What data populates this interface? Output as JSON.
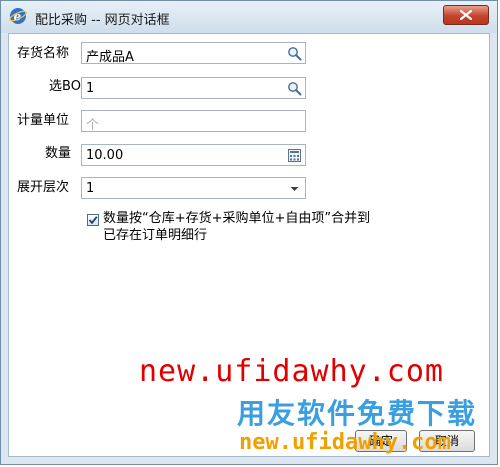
{
  "window": {
    "title": "配比采购 -- 网页对话框"
  },
  "form": {
    "inventory_name": {
      "label": "存货名称",
      "value": "产成品A"
    },
    "bom": {
      "label": "选BOM",
      "value": "1"
    },
    "unit": {
      "label": "计量单位",
      "placeholder": "个"
    },
    "quantity": {
      "label": "数量",
      "value": "10.00"
    },
    "level": {
      "label": "展开层次",
      "value": "1"
    }
  },
  "merge_option": {
    "checked": true,
    "line1": "数量按“仓库+存货+采购单位+自由项”合并到",
    "line2": "已存在订单明细行"
  },
  "buttons": {
    "ok": "确定",
    "cancel": "取消"
  },
  "watermark": {
    "url_red": "new.ufidawhy.com",
    "slogan": "用友软件免费下载",
    "url_orange": "new.ufidawhy.com"
  }
}
